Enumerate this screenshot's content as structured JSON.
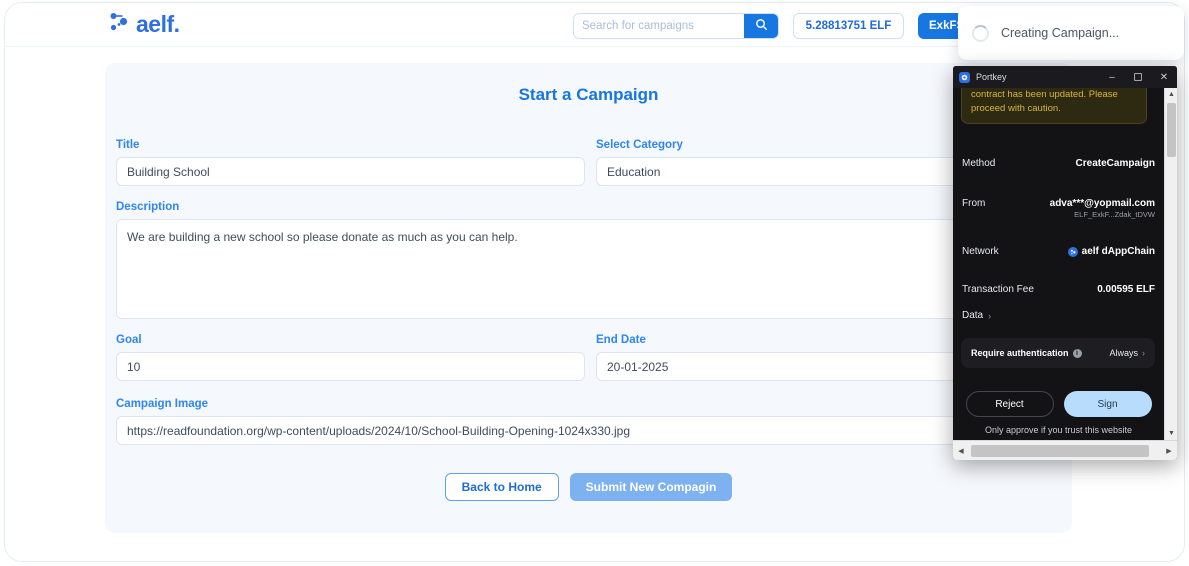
{
  "navbar": {
    "brand": "aelf.",
    "brand_icon": "aelf-logo-icon",
    "search": {
      "placeholder": "Search for campaigns",
      "value": "",
      "icon": "search-icon"
    },
    "balance": "5.28813751 ELF",
    "account": "ExkFS.",
    "avatar_icon": "user-avatar-icon"
  },
  "form": {
    "title": "Start a Campaign",
    "fields": {
      "title": {
        "label": "Title",
        "value": "Building School"
      },
      "category": {
        "label": "Select Category",
        "value": "Education"
      },
      "description": {
        "label": "Description",
        "value": "We are building a new school so please donate as much as you can help."
      },
      "goal": {
        "label": "Goal",
        "value": "10"
      },
      "end_date": {
        "label": "End Date",
        "value": "20-01-2025"
      },
      "campaign_image": {
        "label": "Campaign Image",
        "value": "https://readfoundation.org/wp-content/uploads/2024/10/School-Building-Opening-1024x330.jpg"
      }
    },
    "buttons": {
      "back": "Back to Home",
      "submit": "Submit New Compagin"
    }
  },
  "toast": {
    "message": "Creating Campaign...",
    "icon": "loading-spinner-icon"
  },
  "wallet": {
    "window_title": "Portkey",
    "app_icon": "portkey-icon",
    "controls": {
      "minimize": "–",
      "maximize": "❐",
      "close": "✕"
    },
    "warning": "contract has been updated. Please proceed with caution.",
    "rows": [
      {
        "key": "Method",
        "value": "CreateCampaign"
      },
      {
        "key": "From",
        "value": "adva***@yopmail.com",
        "sub": "ELF_ExkF...Zdak_tDVW"
      },
      {
        "key": "Network",
        "value": "aelf dAppChain",
        "icon": "aelf-network-icon"
      },
      {
        "key": "Transaction Fee",
        "value": "0.00595 ELF"
      }
    ],
    "data_row": {
      "label": "Data",
      "chevron": "›"
    },
    "auth": {
      "label": "Require authentication",
      "info_icon": "info-icon",
      "value": "Always",
      "chevron": "›"
    },
    "buttons": {
      "reject": "Reject",
      "sign": "Sign"
    },
    "note": "Only approve if you trust this website"
  },
  "colors": {
    "brand_blue": "#2f6fe4",
    "accent_blue": "#1777e0",
    "card_bg": "#f5f8fd",
    "wallet_bg": "#131316",
    "warn_yellow": "#d8b53c",
    "sign_blue": "#b8dcfb"
  }
}
